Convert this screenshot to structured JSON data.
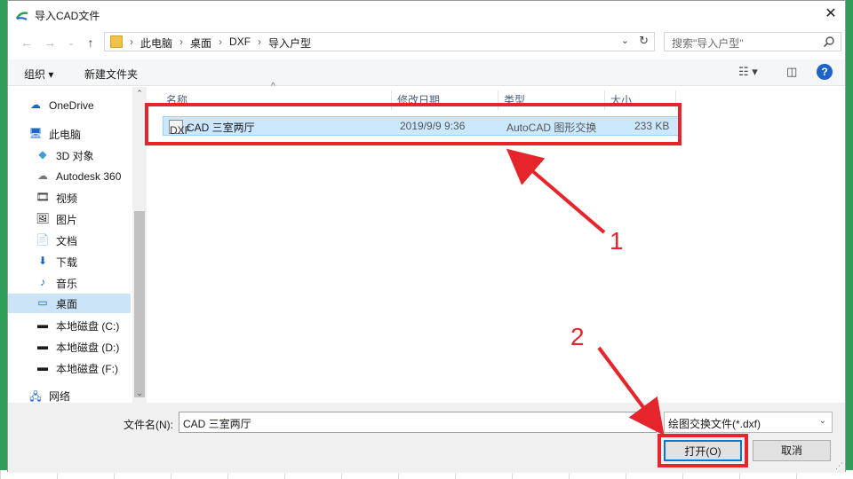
{
  "window": {
    "title": "导入CAD文件",
    "close": "✕"
  },
  "address": {
    "crumbs": [
      "此电脑",
      "桌面",
      "DXF",
      "导入户型"
    ],
    "search_placeholder": "搜索\"导入户型\""
  },
  "toolbar": {
    "organize": "组织 ▾",
    "new_folder": "新建文件夹",
    "help": "?"
  },
  "sidebar": {
    "items": [
      {
        "label": "OneDrive",
        "icon": "cloud-icon",
        "selected": false
      },
      {
        "label": "此电脑",
        "icon": "computer-icon",
        "selected": false
      },
      {
        "label": "3D 对象",
        "icon": "cube-icon",
        "selected": false
      },
      {
        "label": "Autodesk 360",
        "icon": "cloud-drive-icon",
        "selected": false
      },
      {
        "label": "视频",
        "icon": "video-icon",
        "selected": false
      },
      {
        "label": "图片",
        "icon": "picture-icon",
        "selected": false
      },
      {
        "label": "文档",
        "icon": "document-icon",
        "selected": false
      },
      {
        "label": "下载",
        "icon": "download-icon",
        "selected": false
      },
      {
        "label": "音乐",
        "icon": "music-icon",
        "selected": false
      },
      {
        "label": "桌面",
        "icon": "desktop-icon",
        "selected": true
      },
      {
        "label": "本地磁盘 (C:)",
        "icon": "drive-icon",
        "selected": false
      },
      {
        "label": "本地磁盘 (D:)",
        "icon": "drive-icon",
        "selected": false
      },
      {
        "label": "本地磁盘 (F:)",
        "icon": "drive-icon",
        "selected": false
      },
      {
        "label": "网络",
        "icon": "network-icon",
        "selected": false
      }
    ]
  },
  "columns": [
    "名称",
    "修改日期",
    "类型",
    "大小"
  ],
  "files": [
    {
      "name": "CAD 三室两厅",
      "modified": "2019/9/9 9:36",
      "type": "AutoCAD 图形交换",
      "size": "233 KB",
      "icon_label": "DXF"
    }
  ],
  "bottom": {
    "filename_label": "文件名(N):",
    "filename_value": "CAD 三室两厅",
    "filetype_value": "绘图交换文件(*.dxf)",
    "open_label": "打开(O)",
    "cancel_label": "取消"
  },
  "annotations": {
    "callout1": "1",
    "callout2": "2"
  },
  "colors": {
    "annotation_red": "#e5242b",
    "selection_blue": "#cce8ff",
    "accent": "#0078d7"
  }
}
